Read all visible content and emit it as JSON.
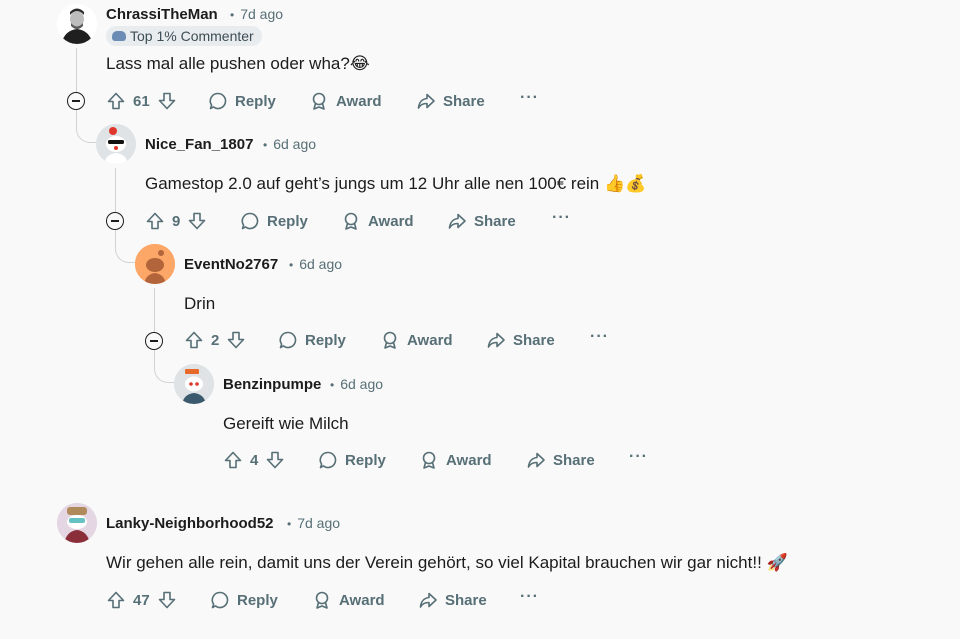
{
  "comments": [
    {
      "username": "ChrassiTheMan",
      "time": "7d ago",
      "flair": "Top 1% Commenter",
      "body": "Lass mal alle pushen oder wha?😂",
      "votes": "61",
      "actions": {
        "reply": "Reply",
        "award": "Award",
        "share": "Share"
      }
    },
    {
      "username": "Nice_Fan_1807",
      "time": "6d ago",
      "body": "Gamestop 2.0 auf geht’s jungs um 12 Uhr alle nen 100€ rein 👍💰",
      "votes": "9",
      "actions": {
        "reply": "Reply",
        "award": "Award",
        "share": "Share"
      }
    },
    {
      "username": "EventNo2767",
      "time": "6d ago",
      "body": "Drin",
      "votes": "2",
      "actions": {
        "reply": "Reply",
        "award": "Award",
        "share": "Share"
      }
    },
    {
      "username": "Benzinpumpe",
      "time": "6d ago",
      "body": "Gereift wie Milch",
      "votes": "4",
      "actions": {
        "reply": "Reply",
        "award": "Award",
        "share": "Share"
      }
    },
    {
      "username": "Lanky-Neighborhood52",
      "time": "7d ago",
      "body": "Wir gehen alle rein, damit uns der Verein gehört, so viel Kapital brauchen wir gar nicht!! 🚀",
      "votes": "47",
      "actions": {
        "reply": "Reply",
        "award": "Award",
        "share": "Share"
      }
    }
  ],
  "icons": {
    "upvote": "upvote-icon",
    "downvote": "downvote-icon",
    "reply": "comment-bubble-icon",
    "award": "award-icon",
    "share": "share-arrow-icon",
    "more": "more-options-icon",
    "collapse": "collapse-thread-icon"
  },
  "colors": {
    "background": "#f9f9f9",
    "secondary_text": "#576f76",
    "thread_line": "#d0d3d5"
  }
}
